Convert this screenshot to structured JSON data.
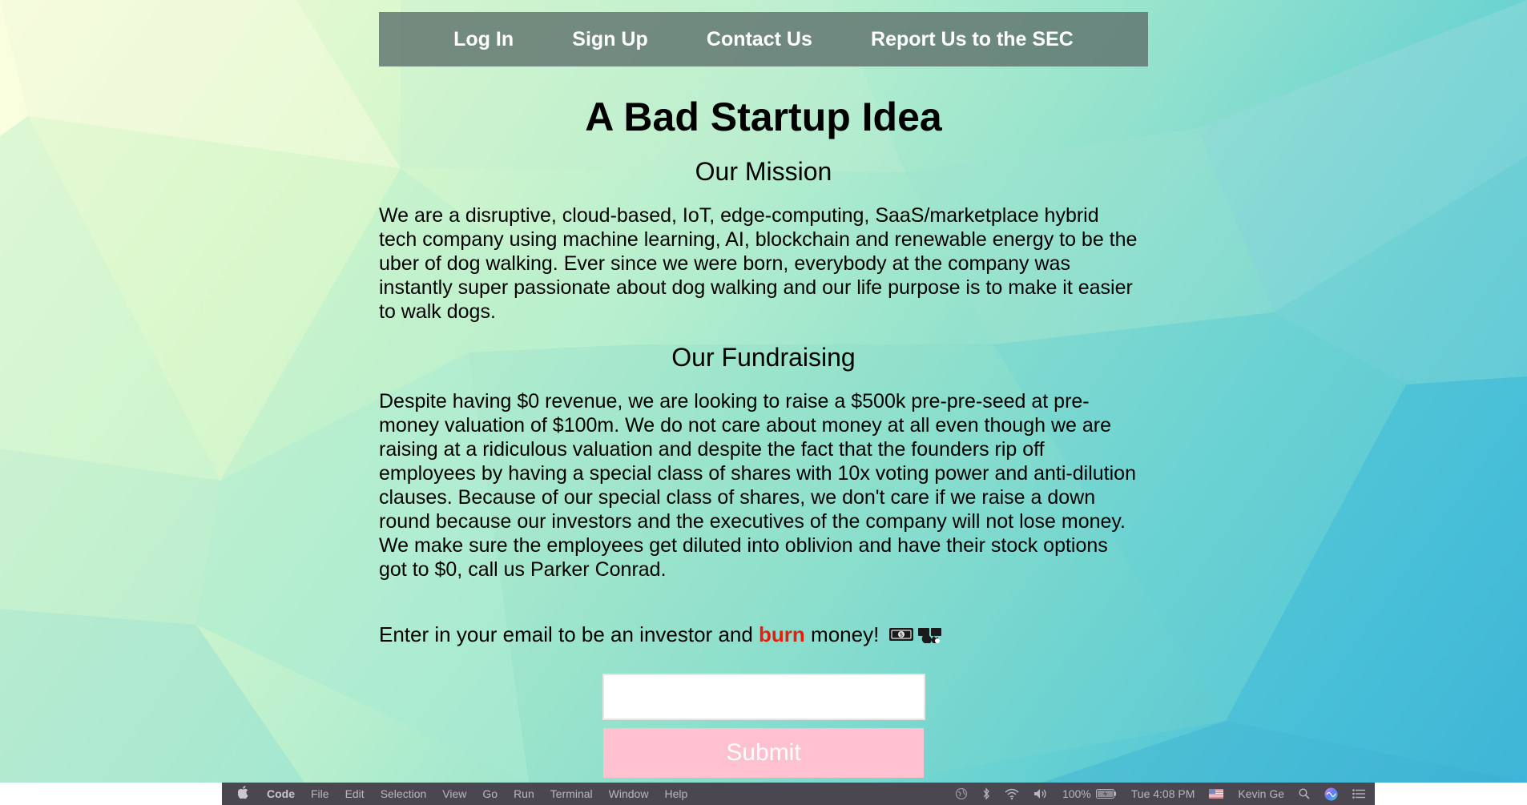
{
  "nav": {
    "items": [
      "Log In",
      "Sign Up",
      "Contact Us",
      "Report Us to the SEC"
    ]
  },
  "page": {
    "title": "A Bad Startup Idea",
    "mission_heading": "Our Mission",
    "mission_text": "We are a disruptive, cloud-based, IoT, edge-computing, SaaS/marketplace hybrid tech company using machine learning, AI, blockchain and renewable energy to be the uber of dog walking. Ever since we were born, everybody at the company was instantly super passionate about dog walking and our life purpose is to make it easier to walk dogs.",
    "fundraising_heading": "Our Fundraising",
    "fundraising_text": "Despite having $0 revenue, we are looking to raise a $500k pre-pre-seed at pre-money valuation of $100m. We do not care about money at all even though we are raising at a ridiculous valuation and despite the fact that the founders rip off employees by having a special class of shares with 10x voting power and anti-dilution clauses. Because of our special class of shares, we don't care if we raise a down round because our investors and the executives of the company will not lose money. We make sure the employees get diluted into oblivion and have their stock options got to $0, call us Parker Conrad.",
    "cta_prefix": "Enter in your email to be an investor and ",
    "cta_highlight": "burn",
    "cta_suffix": " money! ",
    "cta_icons": [
      "banknote-icon",
      "fire-icon"
    ],
    "email_value": "",
    "email_placeholder": "",
    "submit_label": "Submit",
    "burn_color": "#e81d0c",
    "submit_color": "#ffc0cf"
  },
  "menubar": {
    "apple_icon": "apple-icon",
    "items": [
      "Code",
      "File",
      "Edit",
      "Selection",
      "View",
      "Go",
      "Run",
      "Terminal",
      "Window",
      "Help"
    ],
    "battery": "100%",
    "clock": "Tue 4:08 PM",
    "user": "Kevin Ge",
    "status_icons": [
      "globe-icon",
      "bluetooth-icon",
      "wifi-icon",
      "volume-icon",
      "battery-icon",
      "flag-icon",
      "spotlight-icon",
      "siri-icon",
      "notification-center-icon"
    ]
  }
}
